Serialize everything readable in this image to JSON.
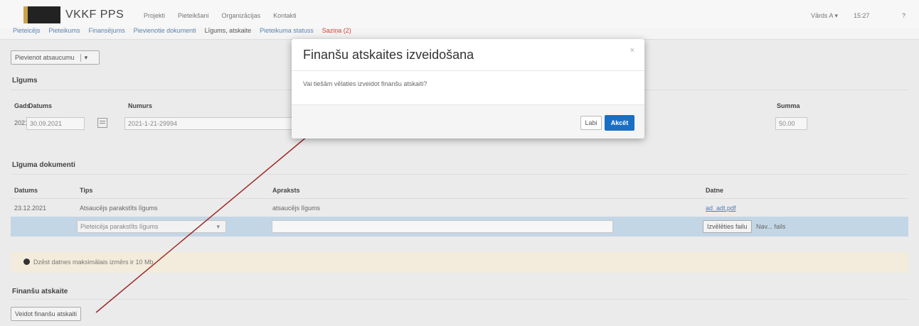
{
  "header": {
    "app_title": "VKKF PPS",
    "nav": [
      "Projekti",
      "Pieteikšani",
      "Organizācijas",
      "Kontakti"
    ],
    "user": "Vārds A ▾",
    "time": "15:27",
    "help": "?"
  },
  "subnav": {
    "tabs": [
      "Pieteicējs",
      "Pieteikums",
      "Finansējums",
      "Pievienotie dokumenti",
      "Līgums, atskaite",
      "Pieteikuma statuss",
      "Saziņa (2)"
    ]
  },
  "toolbar": {
    "dropdown_label": "Pievienot atsaucumu",
    "dropdown_caret": "▾"
  },
  "contract": {
    "title": "Līgums",
    "headers": {
      "year": "Gads",
      "date": "Datums",
      "number": "Numurs",
      "sum": "Summa"
    },
    "values": {
      "year": "2021",
      "date": "30.09.2021",
      "number": "2021-1-21-29994",
      "sum": "50.00"
    }
  },
  "documents": {
    "title": "Līguma dokumenti",
    "headers": {
      "date": "Datums",
      "type": "Tips",
      "desc": "Apraksts",
      "file": "Datne"
    },
    "row": {
      "date": "23.12.2021",
      "type": "Atsaucējs parakstīts līgums",
      "desc": "atsaucējs līgums",
      "file": "ad_adt.pdf"
    },
    "new_row": {
      "type_select": "Pieteicēja parakstīts līgums",
      "file_button": "Izvēlēties failu",
      "file_status": "Nav... fails"
    }
  },
  "info": {
    "message": "Dzēst datnes maksimālais izmērs ir 10 Mb"
  },
  "finance": {
    "title": "Finanšu atskaite",
    "button": "Veidot finanšu atskaiti"
  },
  "modal": {
    "title": "Finanšu atskaites izveidošana",
    "close": "×",
    "body": "Vai tiešām vēlaties izveidot finanšu atskaiti?",
    "cancel": "Labi",
    "confirm": "Akcēt"
  },
  "colors": {
    "primary": "#1a6fc4",
    "selected_row": "#c3d6e6",
    "info_row": "#f3ecdc",
    "arrow": "#a12a2a"
  }
}
